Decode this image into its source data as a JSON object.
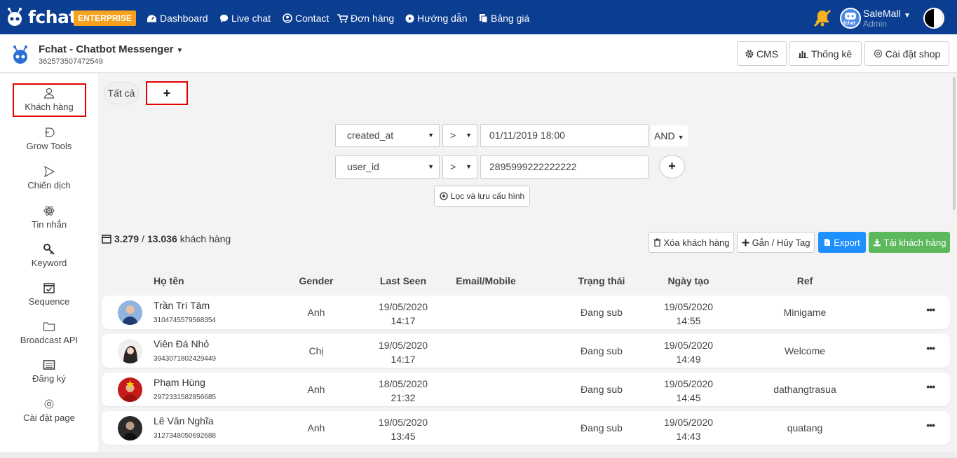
{
  "topbar": {
    "logo_text": "fchat",
    "badge": "ENTERPRISE",
    "nav": [
      {
        "label": "Dashboard",
        "icon": "dashboard-icon"
      },
      {
        "label": "Live chat",
        "icon": "chat-bubble-icon"
      },
      {
        "label": "Contact",
        "icon": "contact-icon"
      },
      {
        "label": "Đơn hàng",
        "icon": "cart-icon"
      },
      {
        "label": "Hướng dẫn",
        "icon": "play-circle-icon"
      },
      {
        "label": "Bảng giá",
        "icon": "copy-icon"
      }
    ],
    "user_name": "SaleMall",
    "user_role": "Admin",
    "avatar_label": "fchat",
    "colors": {
      "bar": "#0b3d91",
      "badge": "#f6a21e",
      "bell": "#f6b21e"
    }
  },
  "page": {
    "title": "Fchat - Chatbot Messenger",
    "id": "362573507472549",
    "buttons": {
      "cms": "CMS",
      "stats": "Thống kê",
      "settings": "Cài đặt shop"
    }
  },
  "sidebar": {
    "items": [
      {
        "label": "Khách hàng",
        "icon": "user-icon"
      },
      {
        "label": "Grow Tools",
        "icon": "grow-tools-icon"
      },
      {
        "label": "Chiến dịch",
        "icon": "send-icon"
      },
      {
        "label": "Tin nhắn",
        "icon": "atom-icon"
      },
      {
        "label": "Keyword",
        "icon": "key-icon"
      },
      {
        "label": "Sequence",
        "icon": "calendar-check-icon"
      },
      {
        "label": "Broadcast API",
        "icon": "folder-icon"
      },
      {
        "label": "Đăng ký",
        "icon": "list-icon"
      },
      {
        "label": "Cài đặt page",
        "icon": "gear-icon"
      }
    ]
  },
  "tabs": {
    "all": "Tất cả",
    "add": "+"
  },
  "filters": [
    {
      "field": "created_at",
      "op": ">",
      "value": "01/11/2019 18:00",
      "join": "AND"
    },
    {
      "field": "user_id",
      "op": ">",
      "value": "2895999222222222"
    }
  ],
  "filter_add": "+",
  "filter_button": "Lọc và lưu cấu hình",
  "summary": {
    "count": "3.279",
    "sep": "/",
    "total": "13.036",
    "unit": "khách hàng"
  },
  "actions": {
    "delete": "Xóa khách hàng",
    "tag": "Gắn / Hủy Tag",
    "export": "Export",
    "download": "Tải khách hàng"
  },
  "table": {
    "headers": {
      "name": "Họ tên",
      "gender": "Gender",
      "last_seen": "Last Seen",
      "email": "Email/Mobile",
      "status": "Trạng thái",
      "created": "Ngày tạo",
      "ref": "Ref"
    },
    "rows": [
      {
        "name": "Trần Trí Tâm",
        "id": "3104745579568354",
        "gender": "Anh",
        "seen_date": "19/05/2020",
        "seen_time": "14:17",
        "email": "",
        "status": "Đang sub",
        "created_date": "19/05/2020",
        "created_time": "14:55",
        "ref": "Minigame"
      },
      {
        "name": "Viên Đá Nhỏ",
        "id": "3943071802429449",
        "gender": "Chị",
        "seen_date": "19/05/2020",
        "seen_time": "14:17",
        "email": "",
        "status": "Đang sub",
        "created_date": "19/05/2020",
        "created_time": "14:49",
        "ref": "Welcome"
      },
      {
        "name": "Phạm Hùng",
        "id": "2972331582856685",
        "gender": "Anh",
        "seen_date": "18/05/2020",
        "seen_time": "21:32",
        "email": "",
        "status": "Đang sub",
        "created_date": "19/05/2020",
        "created_time": "14:45",
        "ref": "dathangtrasua"
      },
      {
        "name": "Lê Văn Nghĩa",
        "id": "3127348050692688",
        "gender": "Anh",
        "seen_date": "19/05/2020",
        "seen_time": "13:45",
        "email": "",
        "status": "Đang sub",
        "created_date": "19/05/2020",
        "created_time": "14:43",
        "ref": "quatang"
      }
    ]
  }
}
